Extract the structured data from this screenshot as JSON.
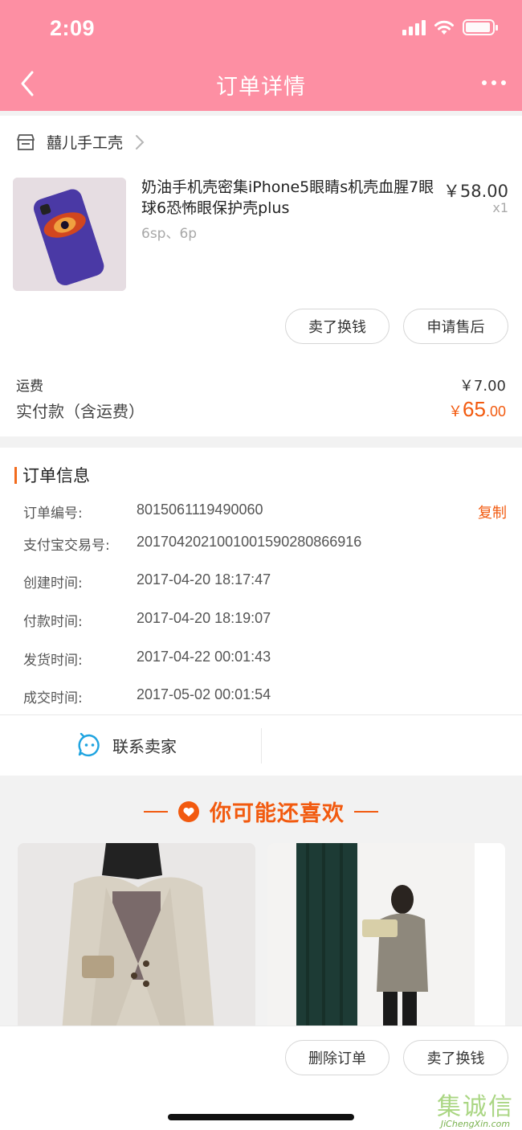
{
  "status_bar": {
    "time": "2:09"
  },
  "nav": {
    "title": "订单详情"
  },
  "store": {
    "name": "囍儿手工壳"
  },
  "product": {
    "title": "奶油手机壳密集iPhone5眼睛s机壳血腥7眼球6恐怖眼保护壳plus",
    "spec": "6sp、6p",
    "price": "￥58.00",
    "qty": "x1",
    "actions": [
      "卖了换钱",
      "申请售后"
    ]
  },
  "fees": {
    "shipping_label": "运费",
    "shipping_value": "￥7.00",
    "paid_label": "实付款（含运费）",
    "paid_currency": "￥",
    "paid_int": "65",
    "paid_dec": ".00"
  },
  "order_info": {
    "title": "订单信息",
    "copy_label": "复制",
    "rows": [
      {
        "key": "订单编号:",
        "value": "8015061119490060"
      },
      {
        "key": "支付宝交易号:",
        "value": "2017042021001001590280866916"
      },
      {
        "key": "创建时间:",
        "value": "2017-04-20 18:17:47"
      },
      {
        "key": "付款时间:",
        "value": "2017-04-20 18:19:07"
      },
      {
        "key": "发货时间:",
        "value": "2017-04-22 00:01:43"
      },
      {
        "key": "成交时间:",
        "value": "2017-05-02 00:01:54"
      }
    ]
  },
  "contact": {
    "label": "联系卖家"
  },
  "recommend": {
    "title": "你可能还喜欢"
  },
  "bottom": {
    "actions": [
      "删除订单",
      "卖了换钱"
    ]
  },
  "watermark": {
    "big": "集诚信",
    "small": "JiChengXin.com"
  },
  "colors": {
    "header": "#fd8fa3",
    "accent": "#f25a0f"
  }
}
